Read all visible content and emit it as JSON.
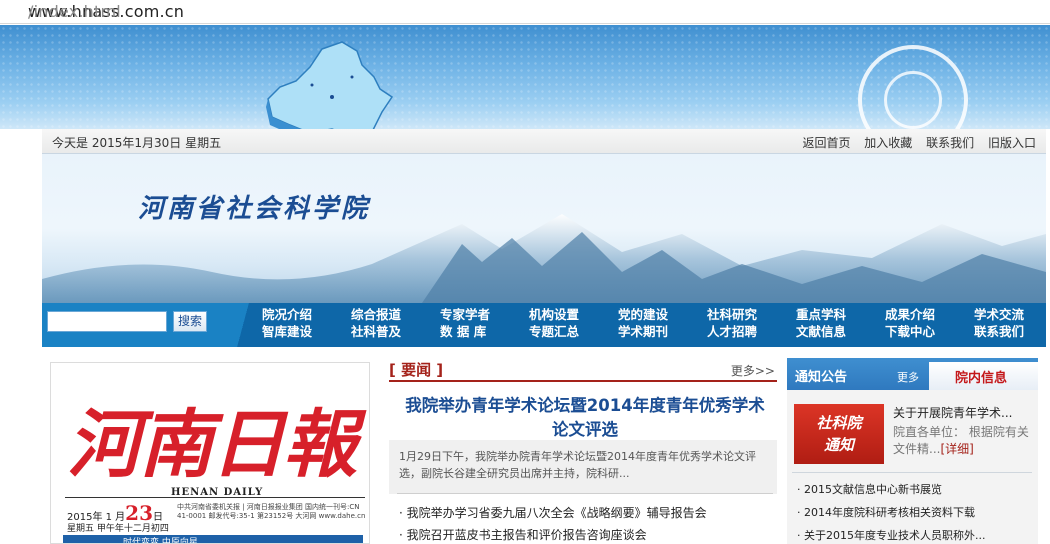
{
  "browser": {
    "url_domain": "www.hnass.com.cn",
    "url_path": "/index.html"
  },
  "topbar": {
    "date_text": "今天是  2015年1月30日  星期五",
    "links": [
      "返回首页",
      "加入收藏",
      "联系我们",
      "旧版入口"
    ]
  },
  "header": {
    "site_title": "河南省社会科学院",
    "seal_text": "河南省社会科学院"
  },
  "search": {
    "placeholder": "",
    "button_label": "搜索"
  },
  "nav": {
    "items": [
      [
        "院况介绍",
        "智库建设"
      ],
      [
        "综合报道",
        "社科普及"
      ],
      [
        "专家学者",
        "数 据 库"
      ],
      [
        "机构设置",
        "专题汇总"
      ],
      [
        "党的建设",
        "学术期刊"
      ],
      [
        "社科研究",
        "人才招聘"
      ],
      [
        "重点学科",
        "文献信息"
      ],
      [
        "成果介绍",
        "下载中心"
      ],
      [
        "学术交流",
        "联系我们"
      ]
    ]
  },
  "newspaper": {
    "title": "河南日報",
    "subtitle_en": "HENAN DAILY",
    "date_prefix": "2015年 1 月",
    "day": "23",
    "date_suffix": "日",
    "weekday": "星期五  甲午年十二月初四",
    "lines": "中共河南省委机关报 | 河南日报报业集团  国内统一刊号:CN 41-0001  邮发代号:35-1  第23152号  大河网 www.dahe.cn",
    "bottom_text": "时代变变  中原向星"
  },
  "news": {
    "section_label": "[ 要闻 ]",
    "more": "更多>>",
    "headline": "我院举办青年学术论坛暨2014年度青年优秀学术论文评选",
    "summary": "1月29日下午，我院举办院青年学术论坛暨2014年度青年优秀学术论文评选，副院长谷建全研究员出席并主持，院科研...",
    "items": [
      "· 我院举办学习省委九届八次全会《战略纲要》辅导报告会",
      "· 我院召开蓝皮书主报告和评价报告咨询座谈会"
    ]
  },
  "notice": {
    "tab1": "通知公告",
    "more": "更多",
    "tab2": "院内信息",
    "badge_line1": "社科院",
    "badge_line2": "通知",
    "title": "关于开展院青年学术...",
    "desc": "院直各单位：  根据院有关文件精...",
    "detail": "[详细]",
    "items": [
      "· 2015文献信息中心新书展览",
      "· 2014年度院科研考核相关资料下载",
      "· 关于2015年度专业技术人员职称外..."
    ]
  },
  "colors": {
    "nav_blue": "#0e67a8",
    "accent_red": "#a4221a",
    "title_blue": "#1b4d93"
  }
}
